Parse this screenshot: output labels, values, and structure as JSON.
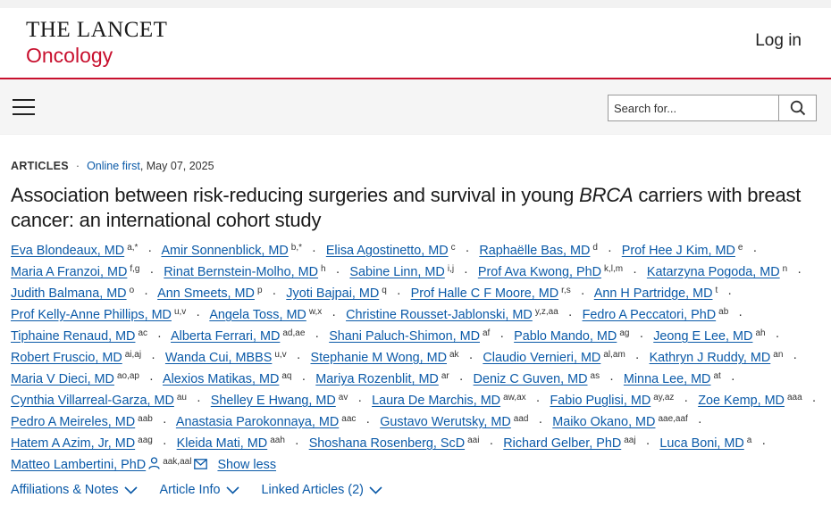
{
  "header": {
    "logo_line1": "THE LANCET",
    "logo_line2": "Oncology",
    "login": "Log in"
  },
  "search": {
    "placeholder": "Search for..."
  },
  "article": {
    "type": "ARTICLES",
    "online_first": "Online first",
    "date": ", May 07, 2025",
    "title_part1": "Association between risk-reducing surgeries and survival in young ",
    "title_italic": "BRCA",
    "title_part2": " carriers with breast cancer: an international cohort study"
  },
  "authors": [
    {
      "name": "Eva Blondeaux, MD",
      "sup": "a,*"
    },
    {
      "name": "Amir Sonnenblick, MD",
      "sup": "b,*"
    },
    {
      "name": "Elisa Agostinetto, MD",
      "sup": "c"
    },
    {
      "name": "Raphaëlle Bas, MD",
      "sup": "d"
    },
    {
      "name": "Prof Hee J Kim, MD",
      "sup": "e"
    },
    {
      "name": "Maria A Franzoi, MD",
      "sup": "f,g"
    },
    {
      "name": "Rinat Bernstein-Molho, MD",
      "sup": "h"
    },
    {
      "name": "Sabine Linn, MD",
      "sup": "i,j"
    },
    {
      "name": "Prof Ava Kwong, PhD",
      "sup": "k,l,m"
    },
    {
      "name": "Katarzyna Pogoda, MD",
      "sup": "n"
    },
    {
      "name": "Judith Balmana, MD",
      "sup": "o"
    },
    {
      "name": "Ann Smeets, MD",
      "sup": "p"
    },
    {
      "name": "Jyoti Bajpai, MD",
      "sup": "q"
    },
    {
      "name": "Prof Halle C F Moore, MD",
      "sup": "r,s"
    },
    {
      "name": "Ann H Partridge, MD",
      "sup": "t"
    },
    {
      "name": "Prof Kelly-Anne Phillips, MD",
      "sup": "u,v"
    },
    {
      "name": "Angela Toss, MD",
      "sup": "w,x"
    },
    {
      "name": "Christine Rousset-Jablonski, MD",
      "sup": "y,z,aa"
    },
    {
      "name": "Fedro A Peccatori, PhD",
      "sup": "ab"
    },
    {
      "name": "Tiphaine Renaud, MD",
      "sup": "ac"
    },
    {
      "name": "Alberta Ferrari, MD",
      "sup": "ad,ae"
    },
    {
      "name": "Shani Paluch-Shimon, MD",
      "sup": "af"
    },
    {
      "name": "Pablo Mando, MD",
      "sup": "ag"
    },
    {
      "name": "Jeong E Lee, MD",
      "sup": "ah"
    },
    {
      "name": "Robert Fruscio, MD",
      "sup": "ai,aj"
    },
    {
      "name": "Wanda Cui, MBBS",
      "sup": "u,v"
    },
    {
      "name": "Stephanie M Wong, MD",
      "sup": "ak"
    },
    {
      "name": "Claudio Vernieri, MD",
      "sup": "al,am"
    },
    {
      "name": "Kathryn J Ruddy, MD",
      "sup": "an"
    },
    {
      "name": "Maria V Dieci, MD",
      "sup": "ao,ap"
    },
    {
      "name": "Alexios Matikas, MD",
      "sup": "aq"
    },
    {
      "name": "Mariya Rozenblit, MD",
      "sup": "ar"
    },
    {
      "name": "Deniz C Guven, MD",
      "sup": "as"
    },
    {
      "name": "Minna Lee, MD",
      "sup": "at"
    },
    {
      "name": "Cynthia Villarreal-Garza, MD",
      "sup": "au"
    },
    {
      "name": "Shelley E Hwang, MD",
      "sup": "av"
    },
    {
      "name": "Laura De Marchis, MD",
      "sup": "aw,ax"
    },
    {
      "name": "Fabio Puglisi, MD",
      "sup": "ay,az"
    },
    {
      "name": "Zoe Kemp, MD",
      "sup": "aaa"
    },
    {
      "name": "Pedro A Meireles, MD",
      "sup": "aab"
    },
    {
      "name": "Anastasia Parokonnaya, MD",
      "sup": "aac"
    },
    {
      "name": "Gustavo Werutsky, MD",
      "sup": "aad"
    },
    {
      "name": "Maiko Okano, MD",
      "sup": "aae,aaf"
    },
    {
      "name": "Hatem A Azim, Jr, MD",
      "sup": "aag"
    },
    {
      "name": "Kleida Mati, MD",
      "sup": "aah"
    },
    {
      "name": "Shoshana Rosenberg, ScD",
      "sup": "aai"
    },
    {
      "name": "Richard Gelber, PhD",
      "sup": "aaj"
    },
    {
      "name": "Luca Boni, MD",
      "sup": "a"
    }
  ],
  "last_author": {
    "name": "Matteo Lambertini, PhD",
    "sup": "aak,aal"
  },
  "show_less": "Show less",
  "links": {
    "affiliations": "Affiliations & Notes",
    "article_info": "Article Info",
    "linked_articles": "Linked Articles (2)"
  },
  "icons": {
    "menu": "hamburger-menu-icon",
    "search": "search-icon",
    "person": "person-icon",
    "mail": "mail-icon",
    "chevron": "chevron-down-icon"
  },
  "colors": {
    "brand_red": "#c8102e",
    "link_blue": "#0b5aa8"
  }
}
